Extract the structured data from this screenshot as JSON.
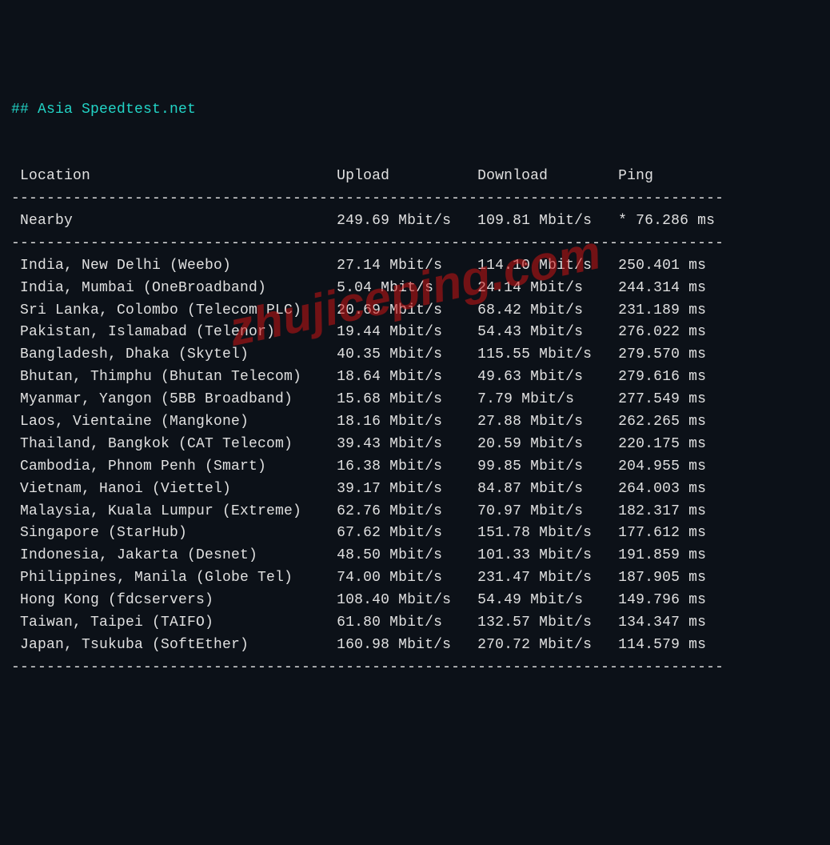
{
  "title": "## Asia Speedtest.net",
  "headers": {
    "location": "Location",
    "upload": "Upload",
    "download": "Download",
    "ping": "Ping"
  },
  "nearby": {
    "location": "Nearby",
    "upload": "249.69 Mbit/s",
    "download": "109.81 Mbit/s",
    "ping": "* 76.286 ms"
  },
  "rows": [
    {
      "location": "India, New Delhi (Weebo)",
      "upload": "27.14 Mbit/s",
      "download": "114.10 Mbit/s",
      "ping": "250.401 ms"
    },
    {
      "location": "India, Mumbai (OneBroadband)",
      "upload": "5.04 Mbit/s",
      "download": "24.14 Mbit/s",
      "ping": "244.314 ms"
    },
    {
      "location": "Sri Lanka, Colombo (Telecom PLC)",
      "upload": "20.69 Mbit/s",
      "download": "68.42 Mbit/s",
      "ping": "231.189 ms"
    },
    {
      "location": "Pakistan, Islamabad (Telenor)",
      "upload": "19.44 Mbit/s",
      "download": "54.43 Mbit/s",
      "ping": "276.022 ms"
    },
    {
      "location": "Bangladesh, Dhaka (Skytel)",
      "upload": "40.35 Mbit/s",
      "download": "115.55 Mbit/s",
      "ping": "279.570 ms"
    },
    {
      "location": "Bhutan, Thimphu (Bhutan Telecom)",
      "upload": "18.64 Mbit/s",
      "download": "49.63 Mbit/s",
      "ping": "279.616 ms"
    },
    {
      "location": "Myanmar, Yangon (5BB Broadband)",
      "upload": "15.68 Mbit/s",
      "download": "7.79 Mbit/s",
      "ping": "277.549 ms"
    },
    {
      "location": "Laos, Vientaine (Mangkone)",
      "upload": "18.16 Mbit/s",
      "download": "27.88 Mbit/s",
      "ping": "262.265 ms"
    },
    {
      "location": "Thailand, Bangkok (CAT Telecom)",
      "upload": "39.43 Mbit/s",
      "download": "20.59 Mbit/s",
      "ping": "220.175 ms"
    },
    {
      "location": "Cambodia, Phnom Penh (Smart)",
      "upload": "16.38 Mbit/s",
      "download": "99.85 Mbit/s",
      "ping": "204.955 ms"
    },
    {
      "location": "Vietnam, Hanoi (Viettel)",
      "upload": "39.17 Mbit/s",
      "download": "84.87 Mbit/s",
      "ping": "264.003 ms"
    },
    {
      "location": "Malaysia, Kuala Lumpur (Extreme)",
      "upload": "62.76 Mbit/s",
      "download": "70.97 Mbit/s",
      "ping": "182.317 ms"
    },
    {
      "location": "Singapore (StarHub)",
      "upload": "67.62 Mbit/s",
      "download": "151.78 Mbit/s",
      "ping": "177.612 ms"
    },
    {
      "location": "Indonesia, Jakarta (Desnet)",
      "upload": "48.50 Mbit/s",
      "download": "101.33 Mbit/s",
      "ping": "191.859 ms"
    },
    {
      "location": "Philippines, Manila (Globe Tel)",
      "upload": "74.00 Mbit/s",
      "download": "231.47 Mbit/s",
      "ping": "187.905 ms"
    },
    {
      "location": "Hong Kong (fdcservers)",
      "upload": "108.40 Mbit/s",
      "download": "54.49 Mbit/s",
      "ping": "149.796 ms"
    },
    {
      "location": "Taiwan, Taipei (TAIFO)",
      "upload": "61.80 Mbit/s",
      "download": "132.57 Mbit/s",
      "ping": "134.347 ms"
    },
    {
      "location": "Japan, Tsukuba (SoftEther)",
      "upload": "160.98 Mbit/s",
      "download": "270.72 Mbit/s",
      "ping": "114.579 ms"
    }
  ],
  "cols": {
    "loc": 36,
    "up": 16,
    "down": 16,
    "ping": 13
  },
  "watermark": "zhujiceping.com"
}
